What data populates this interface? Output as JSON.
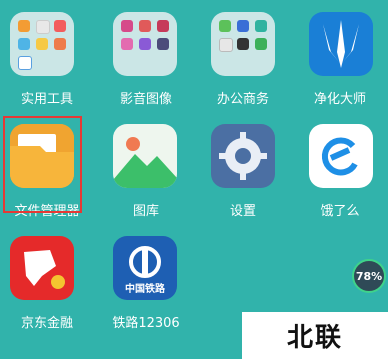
{
  "apps": [
    {
      "label": "实用工具",
      "icon": "utility-folder-icon"
    },
    {
      "label": "影音图像",
      "icon": "media-folder-icon"
    },
    {
      "label": "办公商务",
      "icon": "office-folder-icon"
    },
    {
      "label": "净化大师",
      "icon": "cleaner-trident-icon"
    },
    {
      "label": "文件管理器",
      "icon": "file-manager-folder-icon"
    },
    {
      "label": "图库",
      "icon": "gallery-mountain-icon"
    },
    {
      "label": "设置",
      "icon": "settings-gear-icon"
    },
    {
      "label": "饿了么",
      "icon": "eleme-icon"
    },
    {
      "label": "京东金融",
      "icon": "jd-finance-dog-icon"
    },
    {
      "label": "铁路12306",
      "icon": "railway-logo-icon",
      "icon_text": "中国铁路"
    }
  ],
  "battery_badge": "78%",
  "watermark": "北联",
  "colors": {
    "background": "#31b3ab",
    "highlight": "#e53935"
  }
}
